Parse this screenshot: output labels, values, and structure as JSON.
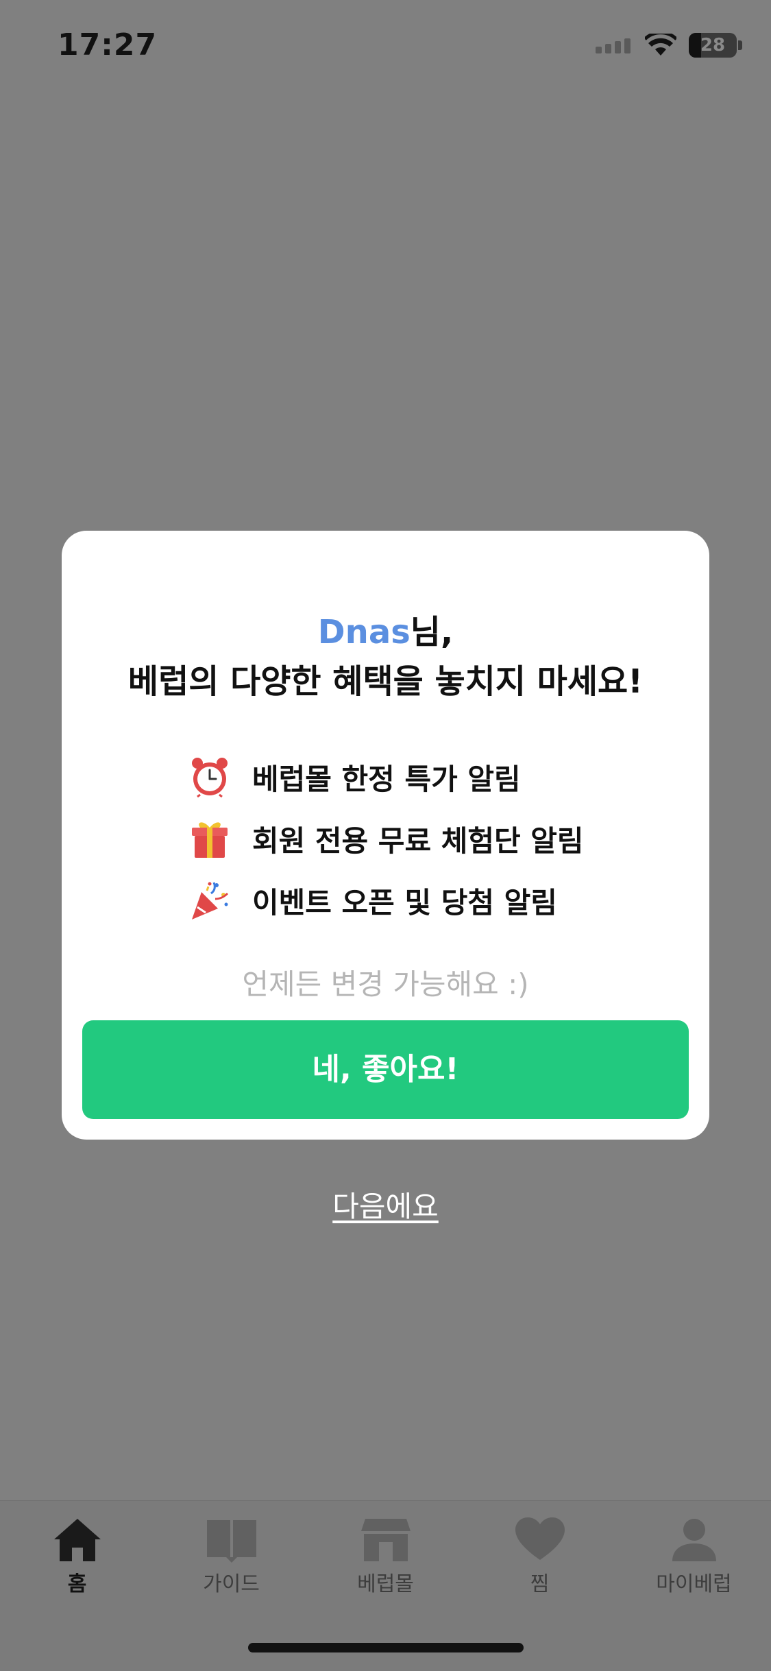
{
  "status_bar": {
    "time": "17:27",
    "battery_level": "28"
  },
  "modal": {
    "title_username": "Dnas",
    "title_suffix": "님,",
    "title_line2": "베럽의 다양한 혜택을 놓치지 마세요!",
    "benefits": [
      {
        "icon": "alarm-clock-icon",
        "label": "베럽몰 한정 특가 알림"
      },
      {
        "icon": "gift-icon",
        "label": "회원 전용 무료 체험단 알림"
      },
      {
        "icon": "party-popper-icon",
        "label": "이벤트 오픈 및 당첨 알림"
      }
    ],
    "note": "언제든 변경 가능해요 :)",
    "confirm_label": "네, 좋아요!"
  },
  "later_label": "다음에요",
  "tab_bar": {
    "tabs": [
      {
        "icon": "home-icon",
        "label": "홈",
        "active": true
      },
      {
        "icon": "book-icon",
        "label": "가이드",
        "active": false
      },
      {
        "icon": "store-icon",
        "label": "베럽몰",
        "active": false
      },
      {
        "icon": "heart-icon",
        "label": "찜",
        "active": false
      },
      {
        "icon": "person-icon",
        "label": "마이베럽",
        "active": false
      }
    ]
  },
  "colors": {
    "accent": "#22c97f",
    "username": "#5b8fe0",
    "overlay": "#808080"
  }
}
